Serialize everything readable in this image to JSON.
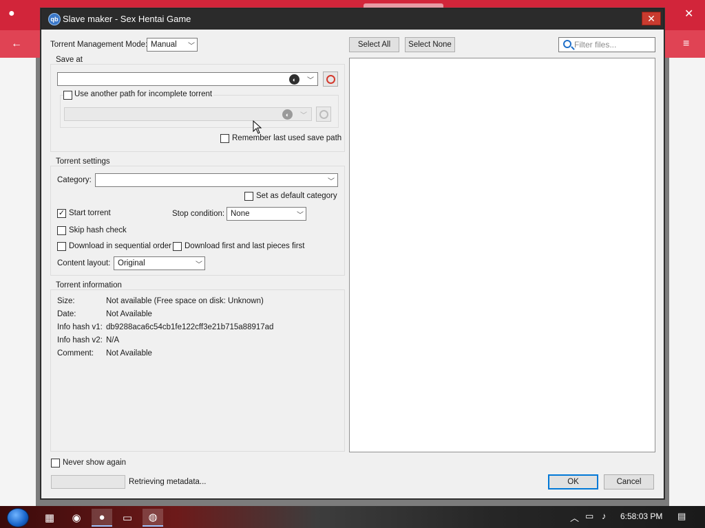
{
  "dialog": {
    "title": "Slave maker - Sex Hentai Game",
    "app_icon_text": "qb",
    "close_glyph": "✕"
  },
  "left": {
    "mode_label": "Torrent Management Mode:",
    "mode_value": "Manual",
    "save_at": {
      "group_label": "Save at",
      "path_value": "",
      "incomplete_label": "Use another path for incomplete torrent",
      "incomplete_checked": false,
      "incomplete_path_value": "",
      "remember_label": "Remember last used save path",
      "remember_checked": false
    },
    "torrent_settings": {
      "group_label": "Torrent settings",
      "category_label": "Category:",
      "category_value": "",
      "default_category_label": "Set as default category",
      "start_torrent_label": "Start torrent",
      "start_torrent_checked": true,
      "stop_condition_label": "Stop condition:",
      "stop_condition_value": "None",
      "skip_hash_label": "Skip hash check",
      "sequential_label": "Download in sequential order",
      "first_last_label": "Download first and last pieces first",
      "content_layout_label": "Content layout:",
      "content_layout_value": "Original"
    },
    "torrent_info": {
      "group_label": "Torrent information",
      "rows": [
        {
          "label": "Size:",
          "value": "Not available (Free space on disk: Unknown)"
        },
        {
          "label": "Date:",
          "value": "Not Available"
        },
        {
          "label": "Info hash v1:",
          "value": "db9288aca6c54cb1fe122cff3e21b715a88917ad"
        },
        {
          "label": "Info hash v2:",
          "value": "N/A"
        },
        {
          "label": "Comment:",
          "value": "Not Available"
        }
      ]
    },
    "never_show_label": "Never show again"
  },
  "right": {
    "select_all": "Select All",
    "select_none": "Select None",
    "filter_placeholder": "Filter files..."
  },
  "footer": {
    "status": "Retrieving metadata...",
    "ok": "OK",
    "cancel": "Cancel"
  },
  "taskbar": {
    "clock": "6:58:03 PM"
  },
  "check_glyph": "✓"
}
